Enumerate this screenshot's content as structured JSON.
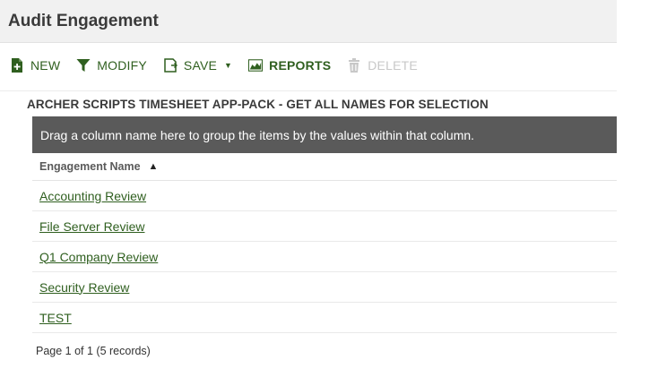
{
  "window": {
    "title": "Audit Engagement"
  },
  "toolbar": {
    "new_label": "NEW",
    "modify_label": "MODIFY",
    "save_label": "SAVE",
    "reports_label": "REPORTS",
    "delete_label": "DELETE",
    "accent": "#2f5f1f",
    "disabled_color": "#c8c8c8"
  },
  "section": {
    "title": "ARCHER SCRIPTS TIMESHEET APP-PACK - GET ALL NAMES FOR SELECTION"
  },
  "grid": {
    "group_hint": "Drag a column name here to group the items by the values within that column.",
    "column_header": "Engagement Name",
    "sort": "ascending",
    "rows": [
      "Accounting Review",
      "File Server Review",
      "Q1 Company Review",
      "Security Review",
      "TEST"
    ],
    "pager": "Page 1 of 1 (5 records)"
  }
}
